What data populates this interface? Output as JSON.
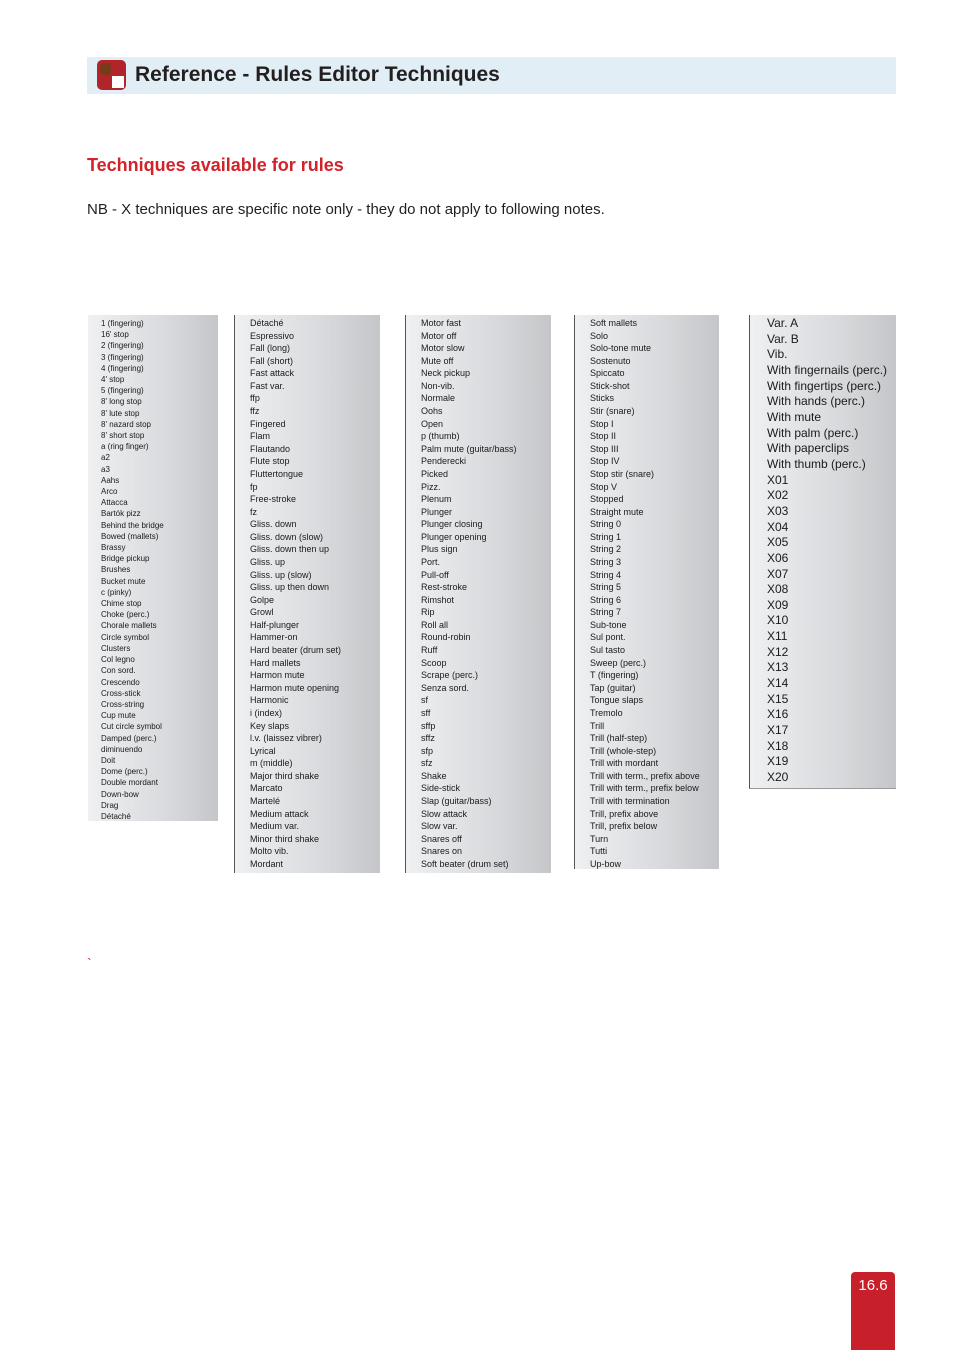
{
  "header": {
    "title": "Reference - Rules Editor Techniques"
  },
  "section_title": "Techniques available for rules",
  "note": "NB - X techniques are specific note only - they do not apply to following notes.",
  "columns": [
    [
      "1 (fingering)",
      "16' stop",
      "2 (fingering)",
      "3 (fingering)",
      "4 (fingering)",
      "4' stop",
      "5 (fingering)",
      "8' long stop",
      "8' lute stop",
      "8' nazard stop",
      "8' short stop",
      "a (ring finger)",
      "a2",
      "a3",
      "Aahs",
      "Arco",
      "Attacca",
      "Bartók pizz",
      "Behind the bridge",
      "Bowed (mallets)",
      "Brassy",
      "Bridge pickup",
      "Brushes",
      "Bucket mute",
      "c (pinky)",
      "Chime stop",
      "Choke (perc.)",
      "Chorale mallets",
      "Circle symbol",
      "Clusters",
      "Col legno",
      "Con sord.",
      "Crescendo",
      "Cross-stick",
      "Cross-string",
      "Cup mute",
      "Cut circle symbol",
      "Damped (perc.)",
      "diminuendo",
      "Doit",
      "Dome (perc.)",
      "Double mordant",
      "Down-bow",
      "Drag",
      "Détaché"
    ],
    [
      "Détaché",
      "Espressivo",
      "Fall (long)",
      "Fall (short)",
      "Fast attack",
      "Fast var.",
      "ffp",
      "ffz",
      "Fingered",
      "Flam",
      "Flautando",
      "Flute stop",
      "Fluttertongue",
      "fp",
      "Free-stroke",
      "fz",
      "Gliss. down",
      "Gliss. down (slow)",
      "Gliss. down then up",
      "Gliss. up",
      "Gliss. up (slow)",
      "Gliss. up then down",
      "Golpe",
      "Growl",
      "Half-plunger",
      "Hammer-on",
      "Hard beater (drum set)",
      "Hard mallets",
      "Harmon mute",
      "Harmon mute opening",
      "Harmonic",
      "i (index)",
      "Key slaps",
      "l.v. (laissez vibrer)",
      "Lyrical",
      "m (middle)",
      "Major third shake",
      "Marcato",
      "Martelé",
      "Medium attack",
      "Medium var.",
      "Minor third shake",
      "Molto vib.",
      "Mordant"
    ],
    [
      "Motor fast",
      "Motor off",
      "Motor slow",
      "Mute off",
      "Neck pickup",
      "Non-vib.",
      "Normale",
      "Oohs",
      "Open",
      "p (thumb)",
      "Palm mute (guitar/bass)",
      "Penderecki",
      "Picked",
      "Pizz.",
      "Plenum",
      "Plunger",
      "Plunger closing",
      "Plunger opening",
      "Plus sign",
      "Port.",
      "Pull-off",
      "Rest-stroke",
      "Rimshot",
      "Rip",
      "Roll all",
      "Round-robin",
      "Ruff",
      "Scoop",
      "Scrape (perc.)",
      "Senza sord.",
      "sf",
      "sff",
      "sffp",
      "sffz",
      "sfp",
      "sfz",
      "Shake",
      "Side-stick",
      "Slap (guitar/bass)",
      "Slow attack",
      "Slow var.",
      "Snares off",
      "Snares on",
      "Soft beater (drum set)"
    ],
    [
      "Soft mallets",
      "Solo",
      "Solo-tone mute",
      "Sostenuto",
      "Spiccato",
      "Stick-shot",
      "Sticks",
      "Stir (snare)",
      "Stop I",
      "Stop II",
      "Stop III",
      "Stop IV",
      "Stop stir (snare)",
      "Stop V",
      "Stopped",
      "Straight mute",
      "String 0",
      "String 1",
      "String 2",
      "String 3",
      "String 4",
      "String 5",
      "String 6",
      "String 7",
      "Sub-tone",
      "Sul pont.",
      "Sul tasto",
      "Sweep (perc.)",
      "T (fingering)",
      "Tap (guitar)",
      "Tongue slaps",
      "Tremolo",
      "Trill",
      "Trill (half-step)",
      "Trill (whole-step)",
      "Trill with mordant",
      "Trill with term., prefix above",
      "Trill with term., prefix below",
      "Trill with termination",
      "Trill, prefix above",
      "Trill, prefix below",
      "Turn",
      "Tutti",
      "Up-bow"
    ],
    [
      "Var. A",
      "Var. B",
      "Vib.",
      "With fingernails (perc.)",
      "With fingertips (perc.)",
      "With hands (perc.)",
      "With mute",
      "With palm (perc.)",
      "With paperclips",
      "With thumb (perc.)",
      "X01",
      "X02",
      "X03",
      "X04",
      "X05",
      "X06",
      "X07",
      "X08",
      "X09",
      "X10",
      "X11",
      "X12",
      "X13",
      "X14",
      "X15",
      "X16",
      "X17",
      "X18",
      "X19",
      "X20"
    ]
  ],
  "stray_mark": "`",
  "page_number": "16.6",
  "colors": {
    "accent": "#d2232a",
    "header_bg": "#e1eef5",
    "page_tab": "#c8202a"
  }
}
